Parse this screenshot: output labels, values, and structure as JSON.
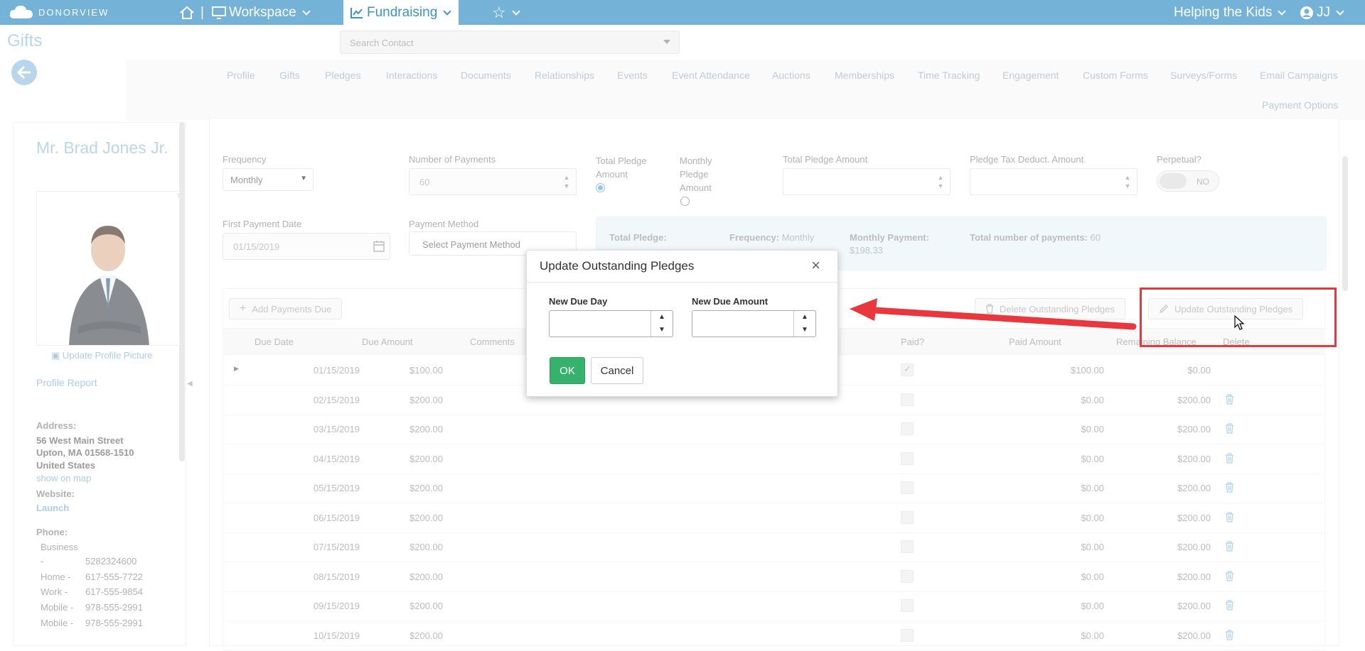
{
  "topbar": {
    "logo": "DONORVIEW",
    "workspace": "Workspace",
    "fundraising": "Fundraising",
    "org": "Helping the Kids",
    "user": "JJ"
  },
  "page": {
    "title": "Gifts"
  },
  "search": {
    "placeholder": "Search Contact"
  },
  "tabs": [
    "Profile",
    "Gifts",
    "Pledges",
    "Interactions",
    "Documents",
    "Relationships",
    "Events",
    "Event Attendance",
    "Auctions",
    "Memberships",
    "Time Tracking",
    "Engagement",
    "Custom Forms",
    "Surveys/Forms",
    "Email Campaigns",
    "Payment Options"
  ],
  "contact": {
    "name": "Mr. Brad Jones Jr.",
    "update_picture": "Update Profile Picture",
    "profile_report": "Profile Report",
    "address_label": "Address:",
    "address_line1": "56 West Main Street",
    "address_line2": "Upton, MA 01568-1510",
    "address_line3": "United States",
    "show_on_map": "show on map",
    "website_label": "Website:",
    "website_value": "Launch",
    "phone_label": "Phone:",
    "phones": [
      {
        "type": "Business",
        "value": "-"
      },
      {
        "type": "",
        "value": "5282324600"
      },
      {
        "type": "Home -",
        "value": "617-555-7722"
      },
      {
        "type": "Work -",
        "value": "617-555-9854"
      },
      {
        "type": "Mobile -",
        "value": "978-555-2991"
      },
      {
        "type": "Mobile -",
        "value": "978-555-2991"
      }
    ]
  },
  "form": {
    "frequency_label": "Frequency",
    "frequency_value": "Monthly",
    "num_payments_label": "Number of Payments",
    "num_payments_value": "60",
    "total_pledge_amount_radio_label": "Total Pledge Amount",
    "monthly_pledge_amount_radio_label": "Monthly Pledge Amount",
    "total_pledge_amount_label": "Total Pledge Amount",
    "pledge_tax_label": "Pledge Tax Deduct. Amount",
    "perpetual_label": "Perpetual?",
    "perpetual_value": "NO",
    "first_payment_label": "First Payment Date",
    "first_payment_value": "01/15/2019",
    "payment_method_label": "Payment Method",
    "payment_method_value": "Select Payment Method"
  },
  "summary": {
    "total_pledge_label": "Total Pledge:",
    "frequency_label": "Frequency:",
    "frequency_value": "Monthly",
    "monthly_payment_label": "Monthly Payment:",
    "monthly_payment_value": "$198.33",
    "total_num_label": "Total number of payments:",
    "total_num_value": "60"
  },
  "grid": {
    "add_payments": "Add Payments Due",
    "delete_outstanding": "Delete Outstanding Pledges",
    "update_outstanding": "Update Outstanding Pledges",
    "columns": [
      "Due Date",
      "Due Amount",
      "Comments",
      "Paid?",
      "Paid Amount",
      "Remaining Balance",
      "Delete"
    ],
    "rows": [
      {
        "date": "01/15/2019",
        "due": "$100.00",
        "paid": true,
        "paid_amount": "$100.00",
        "remaining": "$0.00"
      },
      {
        "date": "02/15/2019",
        "due": "$200.00",
        "paid": false,
        "paid_amount": "$0.00",
        "remaining": "$200.00"
      },
      {
        "date": "03/15/2019",
        "due": "$200.00",
        "paid": false,
        "paid_amount": "$0.00",
        "remaining": "$200.00"
      },
      {
        "date": "04/15/2019",
        "due": "$200.00",
        "paid": false,
        "paid_amount": "$0.00",
        "remaining": "$200.00"
      },
      {
        "date": "05/15/2019",
        "due": "$200.00",
        "paid": false,
        "paid_amount": "$0.00",
        "remaining": "$200.00"
      },
      {
        "date": "06/15/2019",
        "due": "$200.00",
        "paid": false,
        "paid_amount": "$0.00",
        "remaining": "$200.00"
      },
      {
        "date": "07/15/2019",
        "due": "$200.00",
        "paid": false,
        "paid_amount": "$0.00",
        "remaining": "$200.00"
      },
      {
        "date": "08/15/2019",
        "due": "$200.00",
        "paid": false,
        "paid_amount": "$0.00",
        "remaining": "$200.00"
      },
      {
        "date": "09/15/2019",
        "due": "$200.00",
        "paid": false,
        "paid_amount": "$0.00",
        "remaining": "$200.00"
      },
      {
        "date": "10/15/2019",
        "due": "$200.00",
        "paid": false,
        "paid_amount": "$0.00",
        "remaining": "$200.00"
      }
    ]
  },
  "modal": {
    "title": "Update Outstanding Pledges",
    "close": "×",
    "new_due_day_label": "New Due Day",
    "new_due_amount_label": "New Due Amount",
    "ok": "OK",
    "cancel": "Cancel"
  },
  "colors": {
    "topbar": "#75b2d8",
    "accent": "#3c93c6",
    "ok_green": "#37b26c",
    "annotation_red": "#e8383d"
  },
  "icons": [
    "cloud-logo-icon",
    "home-icon",
    "monitor-icon",
    "chart-icon",
    "star-icon",
    "user-circle-icon",
    "back-arrow-icon",
    "camera-icon",
    "calendar-icon",
    "plus-icon",
    "trash-icon",
    "pencil-icon",
    "cursor-icon",
    "expand-icon"
  ]
}
